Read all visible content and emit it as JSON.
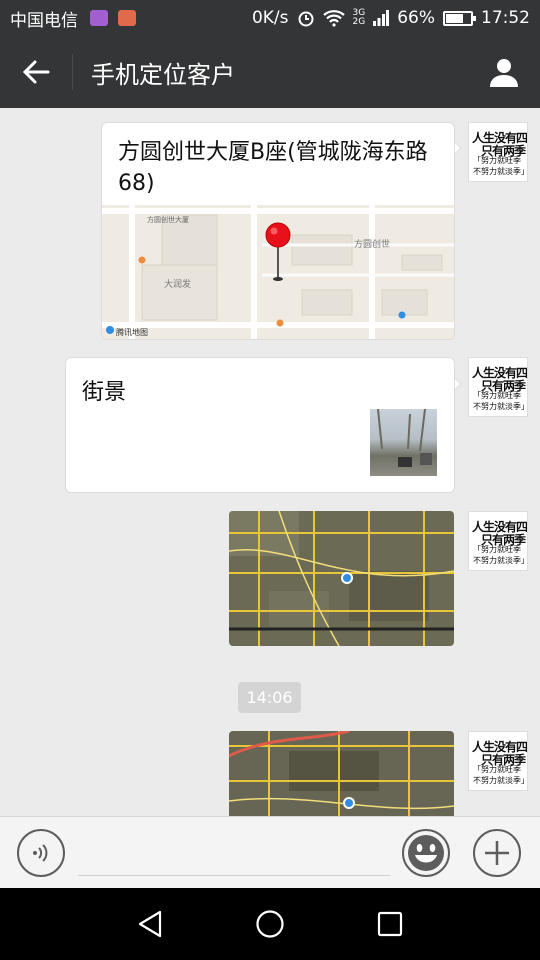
{
  "status_bar": {
    "carrier": "中国电信",
    "net_speed": "0K/s",
    "net_type_top": "3G",
    "net_type_bottom": "2G",
    "battery": "66%",
    "battery_level": 0.66,
    "time": "17:52"
  },
  "nav": {
    "title": "手机定位客户"
  },
  "messages": {
    "location": {
      "title": "方圆创世大厦B座(管城陇海东路68)",
      "map_labels": [
        "方圆创世大厦",
        "方圆创世",
        "大润发",
        "腾讯地图"
      ]
    },
    "street_view": {
      "label": "街景"
    },
    "timestamp": "14:06"
  },
  "avatar": {
    "line1": "人生没有四季",
    "line2": "只有两季",
    "line3": "「努力就旺季",
    "line4": "不努力就淡季」"
  },
  "colors": {
    "header_bg": "#343537",
    "chat_bg": "#ebebeb",
    "pin": "#e8101a"
  }
}
